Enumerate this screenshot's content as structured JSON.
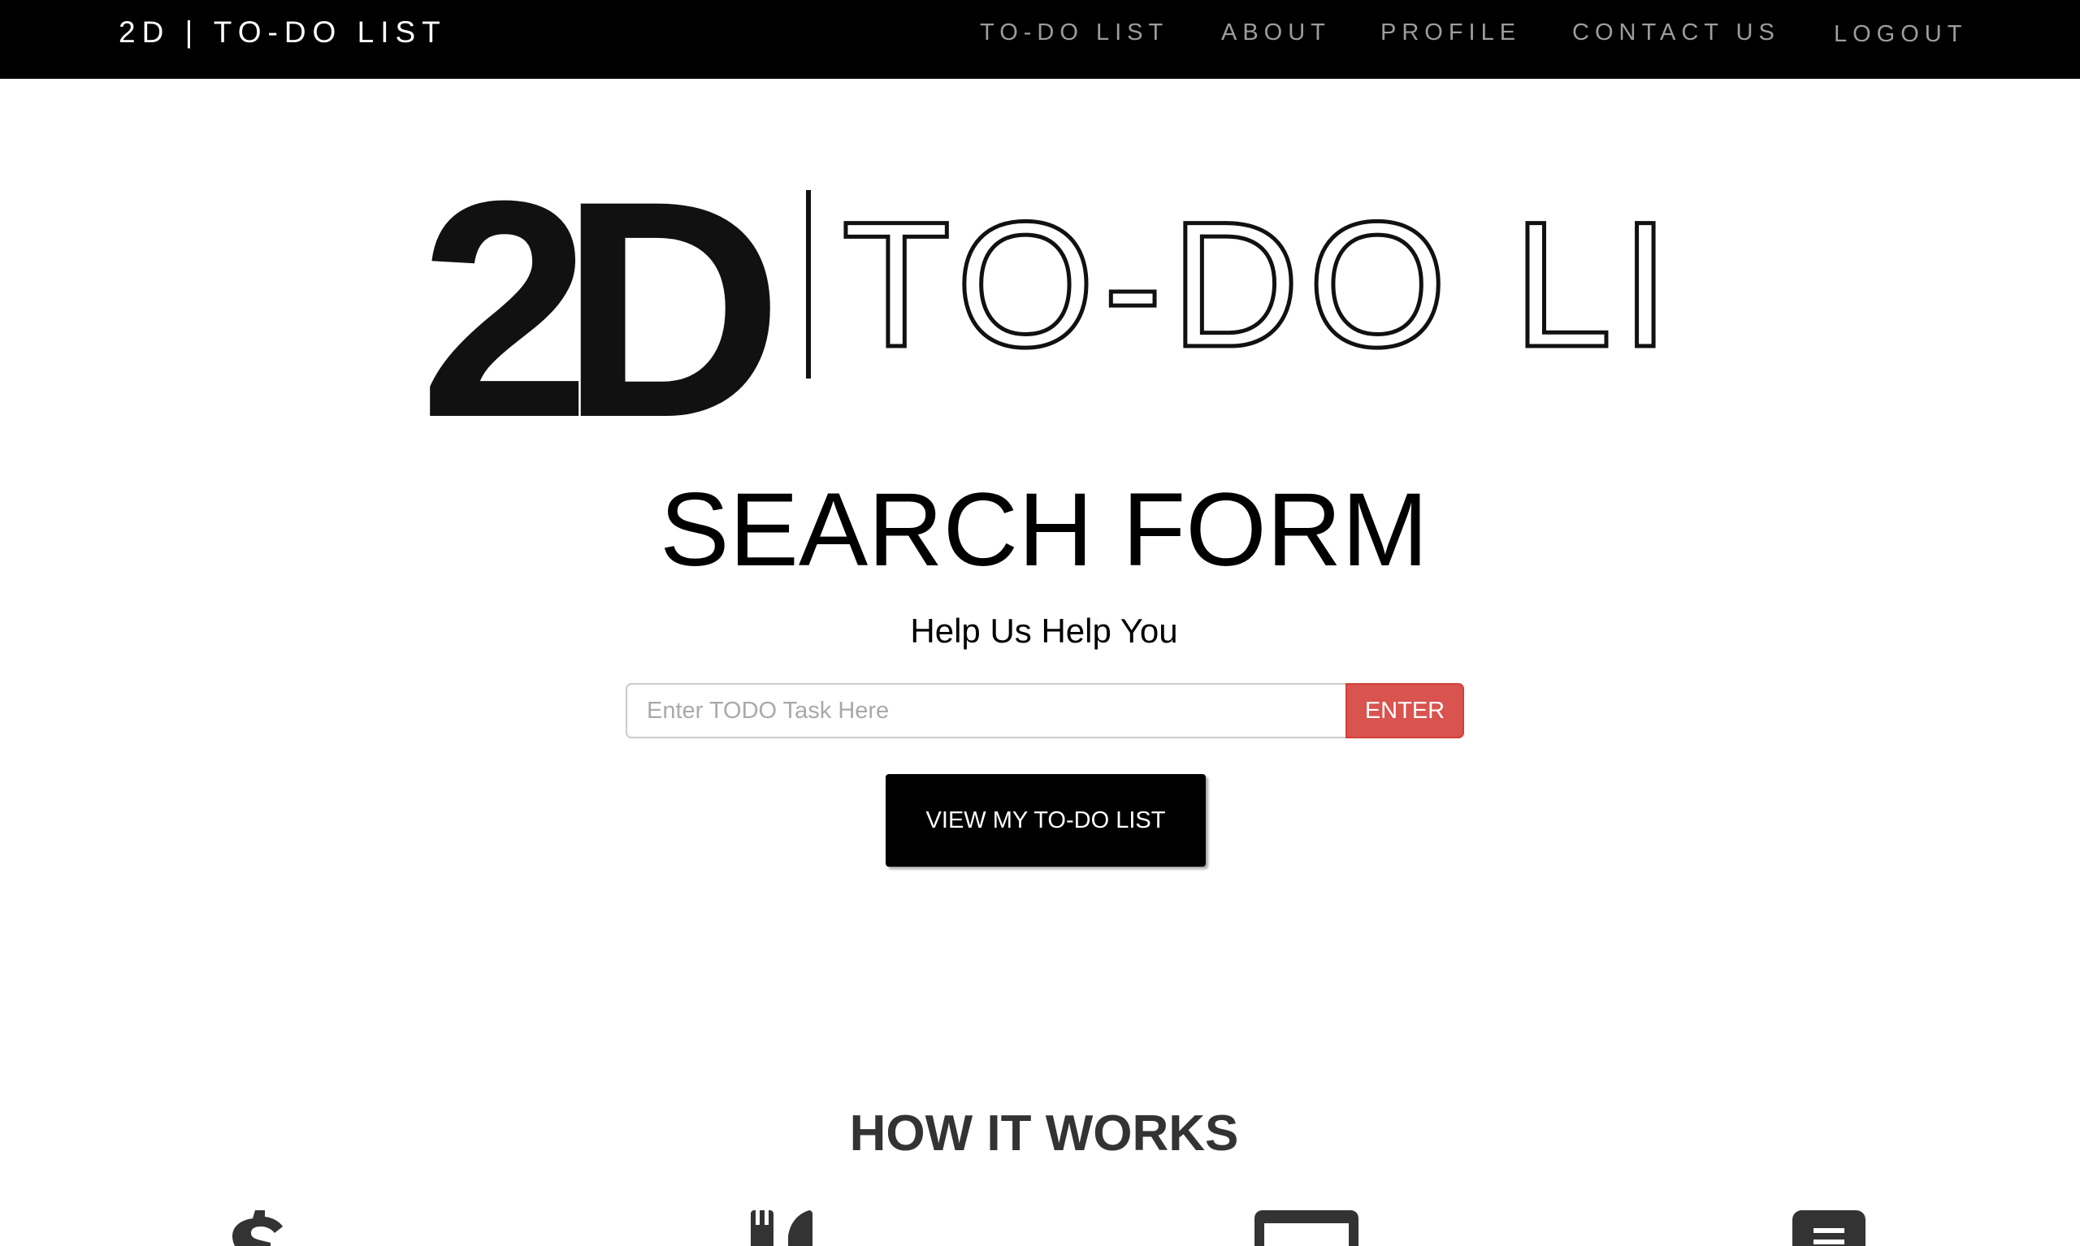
{
  "navbar": {
    "brand": "2D | TO-DO LIST",
    "links": [
      {
        "label": "TO-DO LIST"
      },
      {
        "label": "ABOUT"
      },
      {
        "label": "PROFILE"
      },
      {
        "label": "CONTACT US"
      },
      {
        "label": "LOGOUT"
      }
    ]
  },
  "hero": {
    "logo": {
      "mark": "2D",
      "text": "TO-DO LIST"
    },
    "title": "SEARCH FORM",
    "subtitle": "Help Us Help You",
    "search": {
      "placeholder": "Enter TODO Task Here",
      "value": "",
      "button_label": "ENTER"
    },
    "view_button_label": "VIEW MY TO-DO LIST"
  },
  "how_it_works": {
    "title": "HOW IT WORKS",
    "icons": [
      "dollar-icon",
      "cutlery-icon",
      "monitor-icon",
      "document-icon"
    ]
  },
  "colors": {
    "navbar_bg": "#000000",
    "nav_link": "#9d9d9d",
    "enter_button": "#d9534f",
    "view_button": "#000000",
    "icon": "#333333"
  }
}
